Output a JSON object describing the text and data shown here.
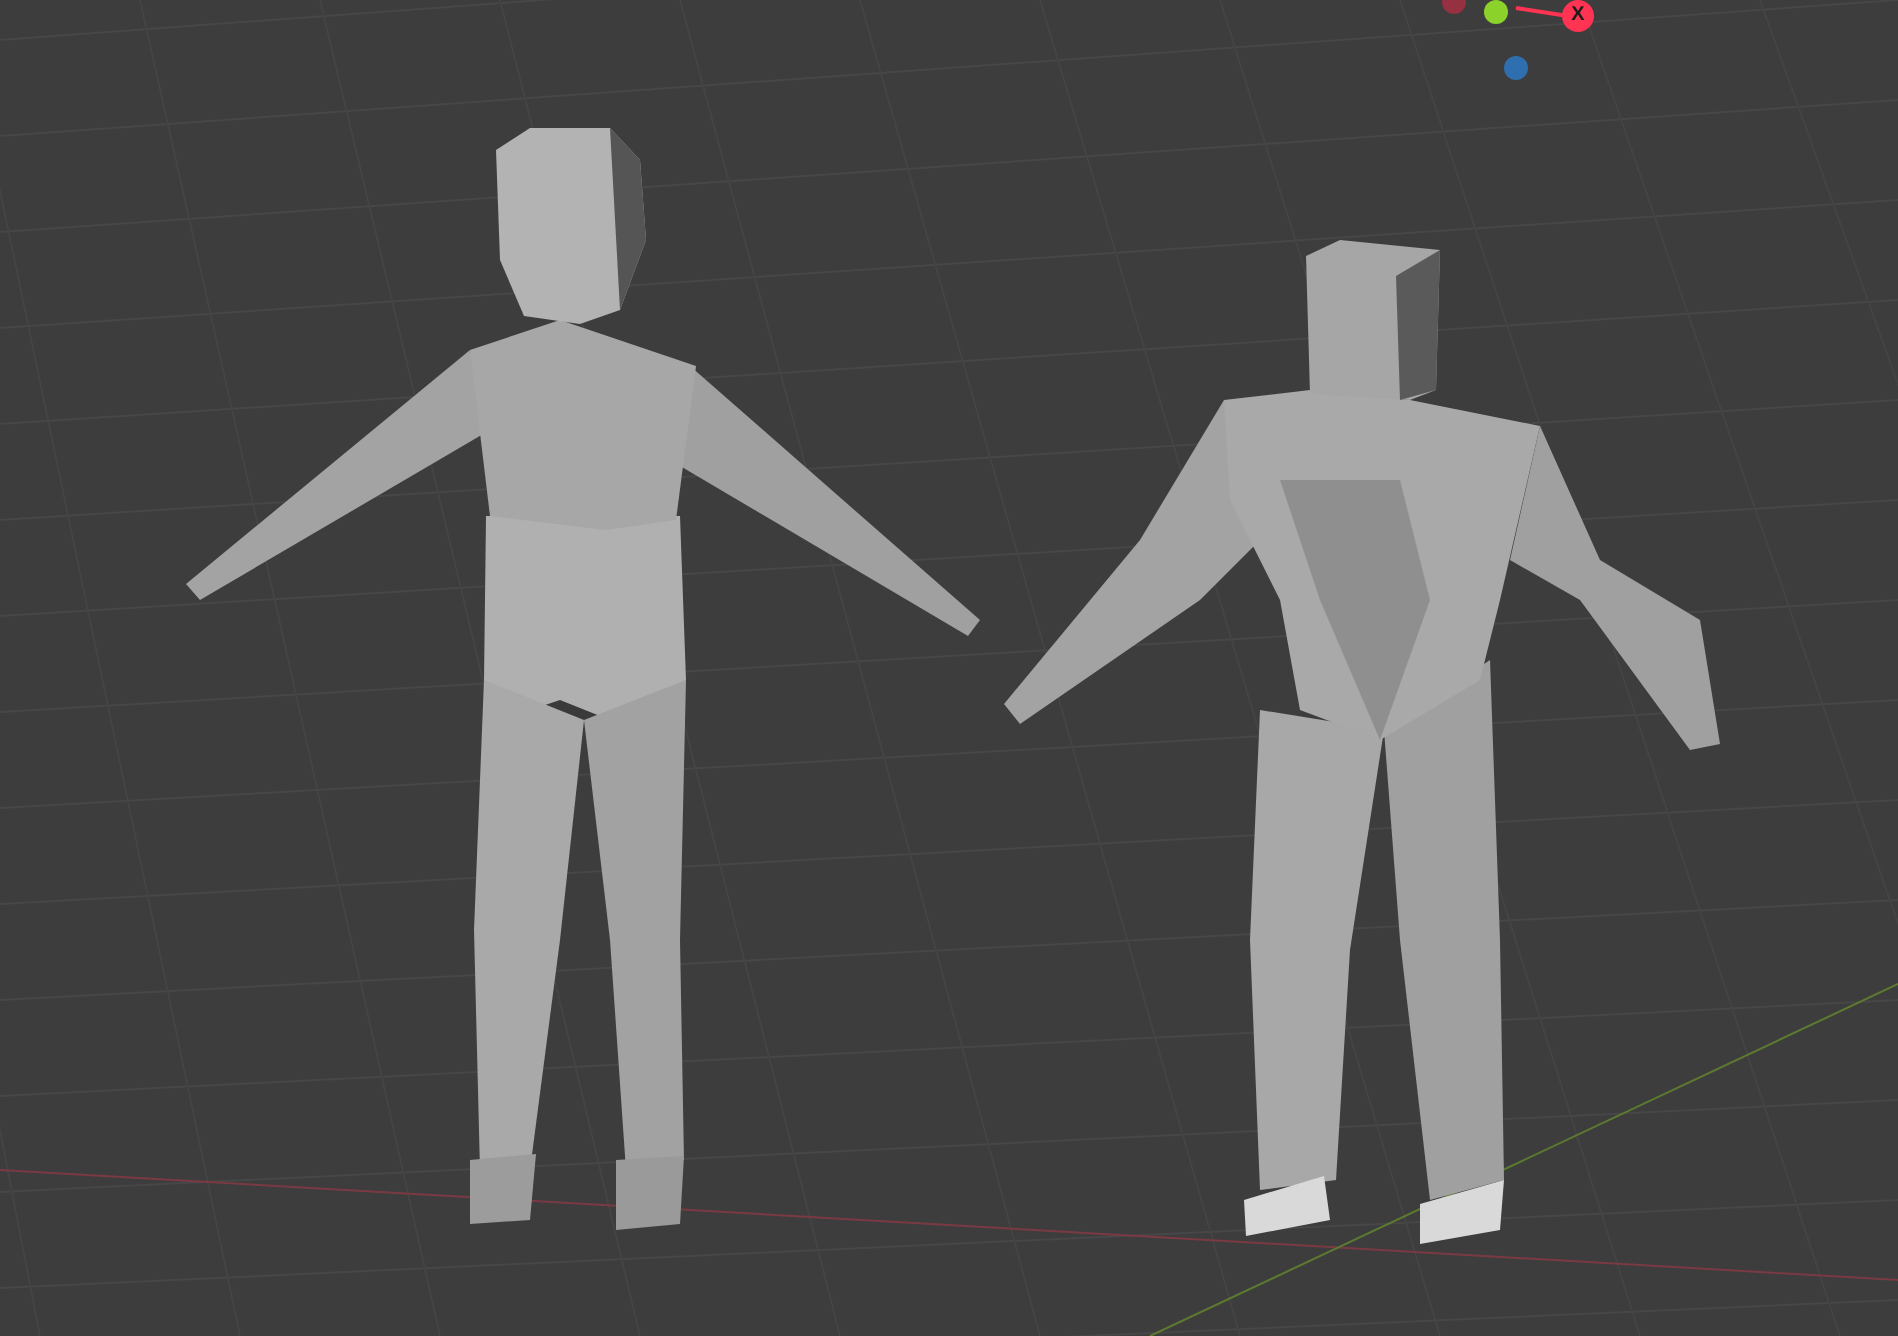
{
  "viewport": {
    "gizmo": {
      "x_axis_label": "X"
    }
  }
}
